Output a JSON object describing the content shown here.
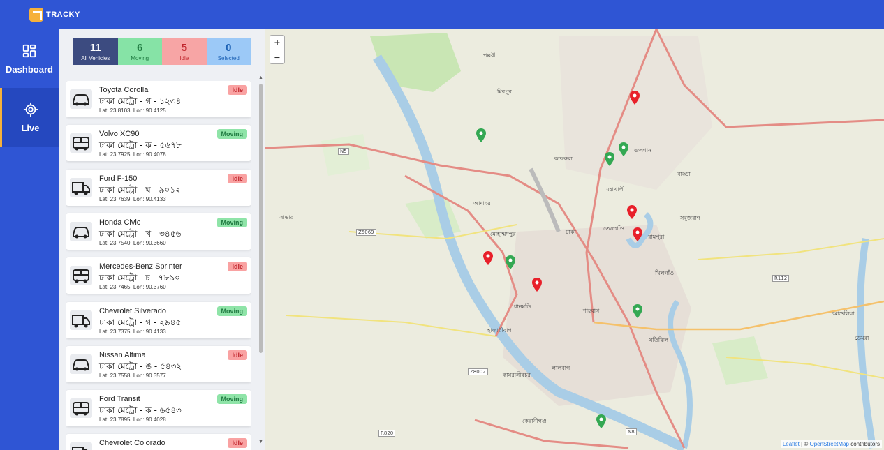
{
  "app": {
    "name": "TRACKY"
  },
  "sidebar": {
    "items": [
      {
        "label": "Dashboard",
        "icon": "dashboard-grid-icon"
      },
      {
        "label": "Live",
        "icon": "crosshair-icon"
      }
    ]
  },
  "stats": {
    "all": {
      "value": "11",
      "label": "All Vehicles"
    },
    "moving": {
      "value": "6",
      "label": "Moving"
    },
    "idle": {
      "value": "5",
      "label": "Idle"
    },
    "selected": {
      "value": "0",
      "label": "Selected"
    }
  },
  "vehicles": [
    {
      "name": "Toyota Corolla",
      "plate": "ঢাকা মেট্রো - গ - ১২৩৪",
      "coords": "Lat: 23.8103, Lon: 90.4125",
      "status": "Idle",
      "type": "car"
    },
    {
      "name": "Volvo XC90",
      "plate": "ঢাকা মেট্রো - ক - ৫৬৭৮",
      "coords": "Lat: 23.7925, Lon: 90.4078",
      "status": "Moving",
      "type": "bus"
    },
    {
      "name": "Ford F-150",
      "plate": "ঢাকা মেট্রো - ঘ - ৯০১২",
      "coords": "Lat: 23.7639, Lon: 90.4133",
      "status": "Idle",
      "type": "truck"
    },
    {
      "name": "Honda Civic",
      "plate": "ঢাকা মেট্রো - খ - ৩৪৫৬",
      "coords": "Lat: 23.7540, Lon: 90.3660",
      "status": "Moving",
      "type": "car"
    },
    {
      "name": "Mercedes-Benz Sprinter",
      "plate": "ঢাকা মেট্রো - চ - ৭৮৯০",
      "coords": "Lat: 23.7465, Lon: 90.3760",
      "status": "Idle",
      "type": "bus"
    },
    {
      "name": "Chevrolet Silverado",
      "plate": "ঢাকা মেট্রো - গ - ২৯৪৫",
      "coords": "Lat: 23.7375, Lon: 90.4133",
      "status": "Moving",
      "type": "truck"
    },
    {
      "name": "Nissan Altima",
      "plate": "ঢাকা মেট্রো - ঙ - ৫৪৩২",
      "coords": "Lat: 23.7558, Lon: 90.3577",
      "status": "Idle",
      "type": "car"
    },
    {
      "name": "Ford Transit",
      "plate": "ঢাকা মেট্রো - ক - ৬৫৪৩",
      "coords": "Lat: 23.7895, Lon: 90.4028",
      "status": "Moving",
      "type": "bus"
    },
    {
      "name": "Chevrolet Colorado",
      "plate": "",
      "coords": "",
      "status": "Idle",
      "type": "truck"
    }
  ],
  "map": {
    "zoom_in": "+",
    "zoom_out": "−",
    "attribution": {
      "leaflet": "Leaflet",
      "sep": " | © ",
      "osm": "OpenStreetMap",
      "suffix": " contributors"
    },
    "labels": [
      "পল্লবী",
      "মিরপুর",
      "বাড্ডা",
      "ঢাকা",
      "শাহবাগ",
      "কাফরুল",
      "মোহাম্মদপুর",
      "রামপুরা",
      "মতিঝিল",
      "গুলশান",
      "আশুলিয়া",
      "ডেমরা",
      "সবুজবাগ",
      "মহাখালী",
      "ধানমন্ডি",
      "লালবাগ",
      "কামরাঙ্গীরচর",
      "হাজারীবাগ",
      "কেরানীগঞ্জ",
      "তেজগাঁও",
      "আদাবর",
      "সাভার",
      "খিলগাঁও"
    ],
    "roads": [
      "N5",
      "Z5069",
      "R112",
      "Z8002",
      "R820",
      "N8"
    ],
    "markers": {
      "moving": "#34a853",
      "idle": "#e8202a"
    }
  }
}
